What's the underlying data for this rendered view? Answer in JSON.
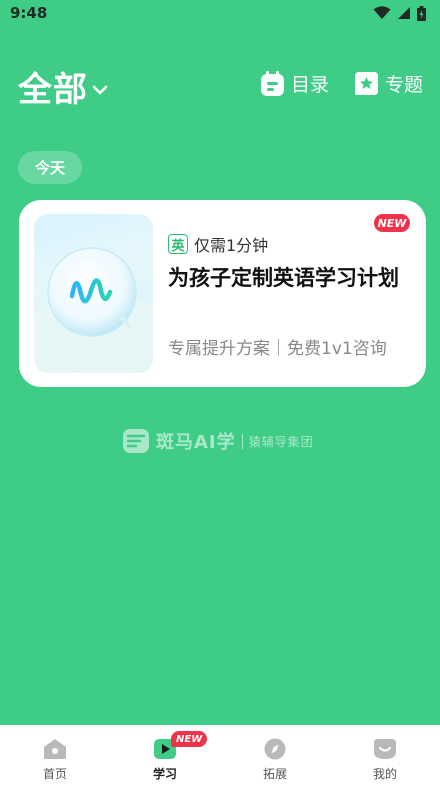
{
  "status_bar": {
    "time": "9:48"
  },
  "header": {
    "title": "全部",
    "catalog_label": "目录",
    "topic_label": "专题"
  },
  "date_chip": "今天",
  "course_card": {
    "badge": "NEW",
    "language_tag": "英",
    "duration": "仅需1分钟",
    "title": "为孩子定制英语学习计划",
    "subtitle": "专属提升方案｜免费1v1咨询"
  },
  "brand": {
    "name": "斑马AI学",
    "group": "猿辅导集团"
  },
  "tab_bar": {
    "items": [
      {
        "label": "首页",
        "icon": "home-icon",
        "active": false
      },
      {
        "label": "学习",
        "icon": "play-icon",
        "active": true,
        "badge": "NEW"
      },
      {
        "label": "拓展",
        "icon": "compass-icon",
        "active": false
      },
      {
        "label": "我的",
        "icon": "profile-icon",
        "active": false
      }
    ]
  },
  "colors": {
    "background": "#3ecc87",
    "accent_red": "#f0324a",
    "tag_green": "#2bbd72"
  }
}
